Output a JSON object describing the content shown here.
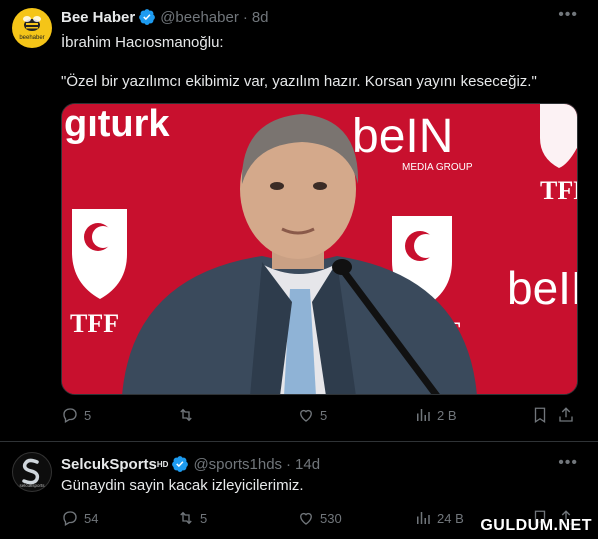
{
  "tweets": [
    {
      "name": "Bee Haber",
      "handle": "@beehaber",
      "age": "8d",
      "avatar_label": "beehaber",
      "text_line1": "İbrahim Hacıosmanoğlu:",
      "text_line2": "\"Özel bir yazılımcı ekibimiz var, yazılım hazır. Korsan yayını keseceğiz.\"",
      "media": {
        "backdrop_texts": [
          "gıturk",
          "beIN",
          "MEDIA GROUP",
          "TFF",
          "TFF",
          "beIN",
          "TFF"
        ]
      },
      "actions": {
        "replies": "5",
        "reposts": "",
        "likes": "5",
        "views": "2 B"
      }
    },
    {
      "name": "SelcukSports",
      "name_badge": "HD",
      "handle": "@sports1hds",
      "age": "14d",
      "avatar_label": "selcuksports",
      "text_line1": "Günaydin sayin kacak izleyicilerimiz.",
      "actions": {
        "replies": "54",
        "reposts": "5",
        "likes": "530",
        "views": "24 B"
      }
    }
  ],
  "separator": "·",
  "watermark": "GULDUM.NET",
  "colors": {
    "background": "#000000",
    "text": "#e7e9ea",
    "muted": "#71767b",
    "verified": "#1d9bf0",
    "backdrop_red": "#c8102e",
    "divider": "#2f3336"
  },
  "icons": [
    "more-icon",
    "verified-icon",
    "reply-icon",
    "repost-icon",
    "like-icon",
    "views-icon",
    "bookmark-icon",
    "share-icon"
  ]
}
